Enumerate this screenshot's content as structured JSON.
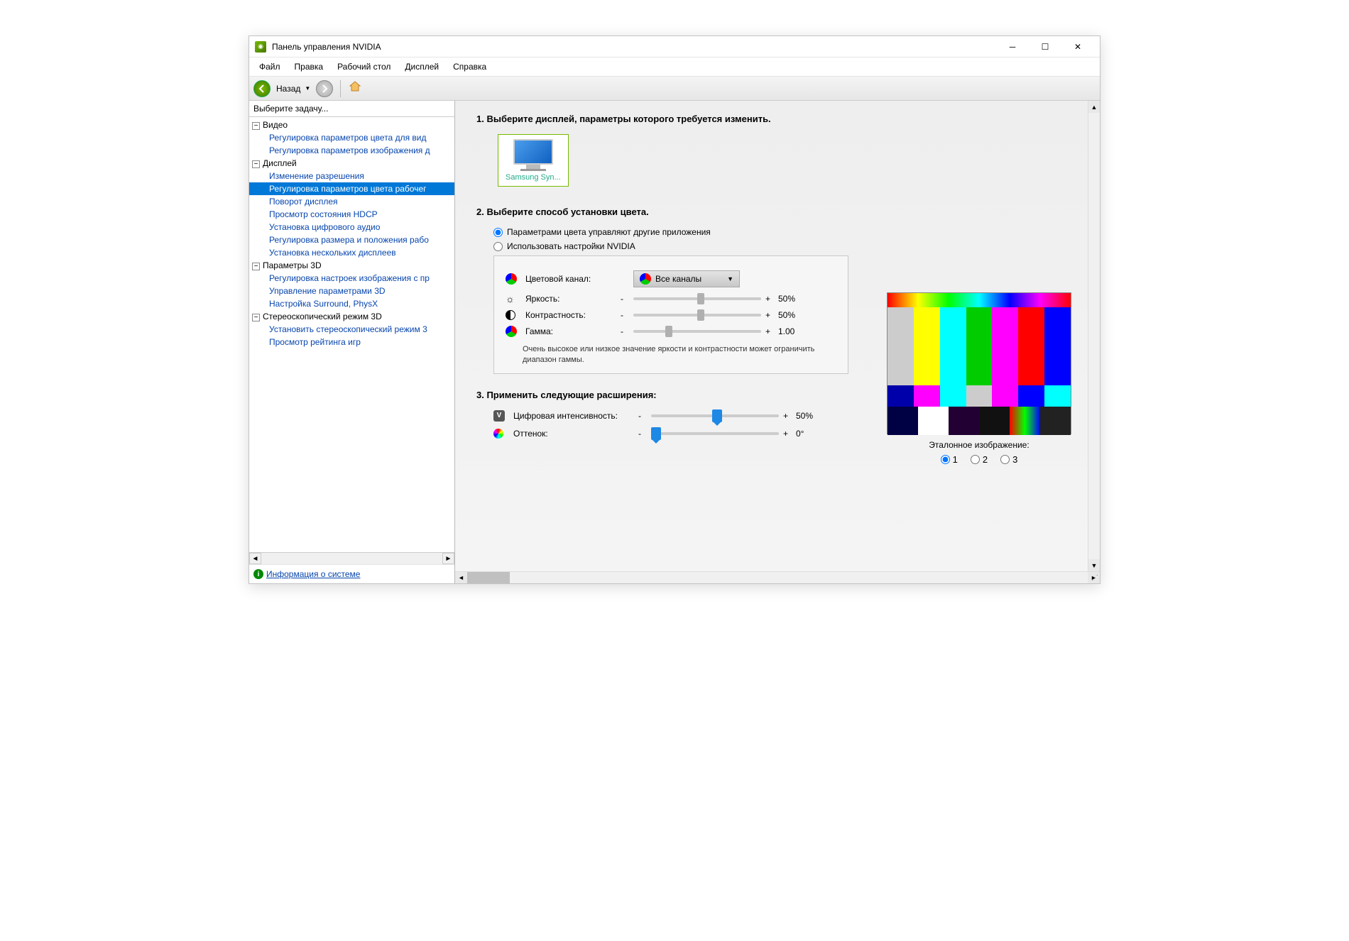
{
  "titlebar": {
    "title": "Панель управления NVIDIA"
  },
  "menu": {
    "file": "Файл",
    "edit": "Правка",
    "desktop": "Рабочий стол",
    "display": "Дисплей",
    "help": "Справка"
  },
  "toolbar": {
    "back": "Назад"
  },
  "sidebar": {
    "header": "Выберите задачу...",
    "groups": [
      {
        "label": "Видео",
        "items": [
          "Регулировка параметров цвета для вид",
          "Регулировка параметров изображения д"
        ]
      },
      {
        "label": "Дисплей",
        "items": [
          "Изменение разрешения",
          "Регулировка параметров цвета рабочег",
          "Поворот дисплея",
          "Просмотр состояния HDCP",
          "Установка цифрового аудио",
          "Регулировка размера и положения рабо",
          "Установка нескольких дисплеев"
        ]
      },
      {
        "label": "Параметры 3D",
        "items": [
          "Регулировка настроек изображения с пр",
          "Управление параметрами 3D",
          "Настройка Surround, PhysX"
        ]
      },
      {
        "label": "Стереоскопический режим 3D",
        "items": [
          "Установить стереоскопический режим 3",
          "Просмотр рейтинга игр"
        ]
      }
    ],
    "selected": "Регулировка параметров цвета рабочег",
    "sysinfo": "Информация о системе"
  },
  "content": {
    "step1": "1. Выберите дисплей, параметры которого требуется изменить.",
    "display_name": "Samsung Syn...",
    "step2": "2. Выберите способ установки цвета.",
    "radio_other": "Параметрами цвета управляют другие приложения",
    "radio_nvidia": "Использовать настройки NVIDIA",
    "channel_label": "Цветовой канал:",
    "channel_value": "Все каналы",
    "brightness": {
      "label": "Яркость:",
      "val": "50%"
    },
    "contrast": {
      "label": "Контрастность:",
      "val": "50%"
    },
    "gamma": {
      "label": "Гамма:",
      "val": "1.00"
    },
    "warn": "Очень высокое или низкое значение яркости и контрастности может ограничить диапазон гаммы.",
    "step3": "3. Применить следующие расширения:",
    "vibrance": {
      "label": "Цифровая интенсивность:",
      "val": "50%"
    },
    "hue": {
      "label": "Оттенок:",
      "val": "0°"
    },
    "reference": {
      "label": "Эталонное изображение:",
      "opt1": "1",
      "opt2": "2",
      "opt3": "3"
    },
    "minus": "-",
    "plus": "+"
  }
}
